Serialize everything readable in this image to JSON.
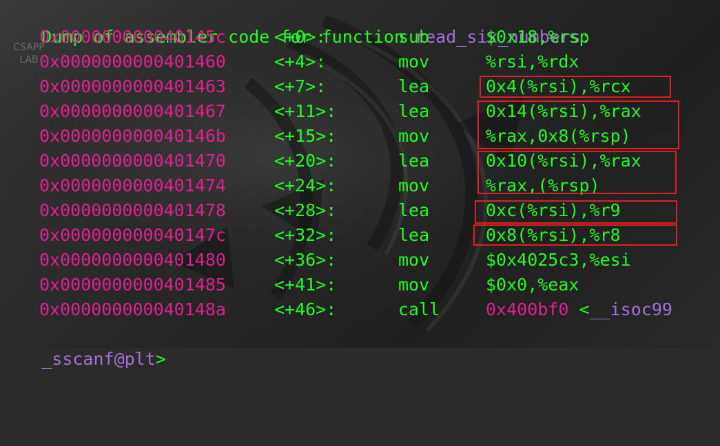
{
  "desktop_icon": {
    "line1": "CSAPP",
    "line2": "LAB"
  },
  "header": {
    "prefix": "Dump of assembler code for function ",
    "function_name": "read_six_numbers",
    "suffix": ":"
  },
  "rows": [
    {
      "addr": "0x000000000040145c",
      "offset": "<+0>:",
      "op": "sub",
      "args": "$0x18,%rsp"
    },
    {
      "addr": "0x0000000000401460",
      "offset": "<+4>:",
      "op": "mov",
      "args": "%rsi,%rdx"
    },
    {
      "addr": "0x0000000000401463",
      "offset": "<+7>:",
      "op": "lea",
      "args": "0x4(%rsi),%rcx"
    },
    {
      "addr": "0x0000000000401467",
      "offset": "<+11>:",
      "op": "lea",
      "args": "0x14(%rsi),%rax"
    },
    {
      "addr": "0x000000000040146b",
      "offset": "<+15>:",
      "op": "mov",
      "args": "%rax,0x8(%rsp)"
    },
    {
      "addr": "0x0000000000401470",
      "offset": "<+20>:",
      "op": "lea",
      "args": "0x10(%rsi),%rax"
    },
    {
      "addr": "0x0000000000401474",
      "offset": "<+24>:",
      "op": "mov",
      "args": "%rax,(%rsp)"
    },
    {
      "addr": "0x0000000000401478",
      "offset": "<+28>:",
      "op": "lea",
      "args": "0xc(%rsi),%r9"
    },
    {
      "addr": "0x000000000040147c",
      "offset": "<+32>:",
      "op": "lea",
      "args": "0x8(%rsi),%r8"
    },
    {
      "addr": "0x0000000000401480",
      "offset": "<+36>:",
      "op": "mov",
      "args": "$0x4025c3,%esi"
    },
    {
      "addr": "0x0000000000401485",
      "offset": "<+41>:",
      "op": "mov",
      "args": "$0x0,%eax"
    }
  ],
  "call_row": {
    "addr": "0x000000000040148a",
    "offset": "<+46>:",
    "op": "call",
    "target_addr": "0x400bf0",
    "target_open": " <",
    "target_name_part1": "__isoc99",
    "target_name_part2": "_sscanf@plt",
    "target_close": ">"
  },
  "colors": {
    "text_green": "#22ff22",
    "address_magenta": "#e0208f",
    "function_purple": "#a46fd4",
    "highlight_red": "#e02020"
  }
}
